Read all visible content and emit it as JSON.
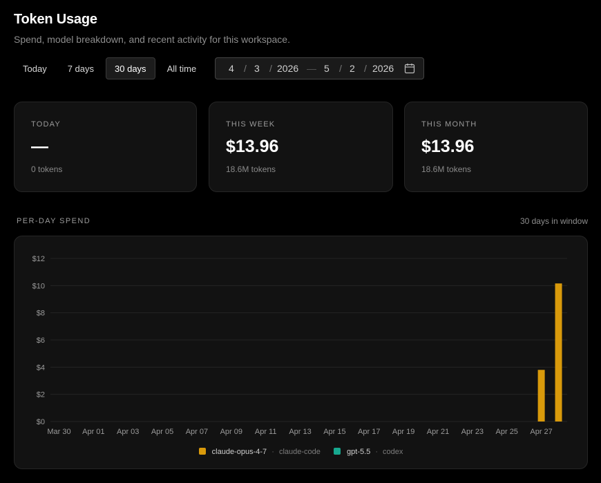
{
  "header": {
    "title": "Token Usage",
    "subtitle": "Spend, model breakdown, and recent activity for this workspace."
  },
  "range_tabs": [
    {
      "label": "Today",
      "active": false
    },
    {
      "label": "7 days",
      "active": false
    },
    {
      "label": "30 days",
      "active": true
    },
    {
      "label": "All time",
      "active": false
    }
  ],
  "date_range": {
    "start": {
      "month": "4",
      "day": "3",
      "year": "2026"
    },
    "end": {
      "month": "5",
      "day": "2",
      "year": "2026"
    },
    "separator": "/",
    "dash": "—",
    "icon": "calendar-icon"
  },
  "stats": [
    {
      "label": "TODAY",
      "value": "—",
      "sub": "0 tokens"
    },
    {
      "label": "THIS WEEK",
      "value": "$13.96",
      "sub": "18.6M tokens"
    },
    {
      "label": "THIS MONTH",
      "value": "$13.96",
      "sub": "18.6M tokens"
    }
  ],
  "section": {
    "label": "PER-DAY SPEND",
    "note": "30 days in window"
  },
  "legend": [
    {
      "model": "claude-opus-4-7",
      "source": "claude-code",
      "color": "#d99a0b"
    },
    {
      "model": "gpt-5.5",
      "source": "codex",
      "color": "#17a88f"
    }
  ],
  "chart_data": {
    "type": "bar",
    "stacked": true,
    "categories": [
      "Mar 30",
      "Mar 31",
      "Apr 01",
      "Apr 02",
      "Apr 03",
      "Apr 04",
      "Apr 05",
      "Apr 06",
      "Apr 07",
      "Apr 08",
      "Apr 09",
      "Apr 10",
      "Apr 11",
      "Apr 12",
      "Apr 13",
      "Apr 14",
      "Apr 15",
      "Apr 16",
      "Apr 17",
      "Apr 18",
      "Apr 19",
      "Apr 20",
      "Apr 21",
      "Apr 22",
      "Apr 23",
      "Apr 24",
      "Apr 25",
      "Apr 26",
      "Apr 27",
      "Apr 28"
    ],
    "tick_labels": [
      "Mar 30",
      "Apr 01",
      "Apr 03",
      "Apr 05",
      "Apr 07",
      "Apr 09",
      "Apr 11",
      "Apr 13",
      "Apr 15",
      "Apr 17",
      "Apr 19",
      "Apr 21",
      "Apr 23",
      "Apr 25",
      "Apr 27"
    ],
    "y_ticks": [
      "$0",
      "$2",
      "$4",
      "$6",
      "$8",
      "$10",
      "$12"
    ],
    "ylim": [
      0,
      12
    ],
    "grid": true,
    "series": [
      {
        "name": "claude-opus-4-7",
        "color": "#d99a0b",
        "values": [
          0,
          0,
          0,
          0,
          0,
          0,
          0,
          0,
          0,
          0,
          0,
          0,
          0,
          0,
          0,
          0,
          0,
          0,
          0,
          0,
          0,
          0,
          0,
          0,
          0,
          0,
          0,
          0,
          3.8,
          10.16
        ]
      },
      {
        "name": "gpt-5.5",
        "color": "#17a88f",
        "values": [
          0,
          0,
          0,
          0,
          0,
          0,
          0,
          0,
          0,
          0,
          0,
          0,
          0,
          0,
          0,
          0,
          0,
          0,
          0,
          0,
          0,
          0,
          0,
          0,
          0,
          0,
          0,
          0,
          0,
          0
        ]
      }
    ]
  }
}
